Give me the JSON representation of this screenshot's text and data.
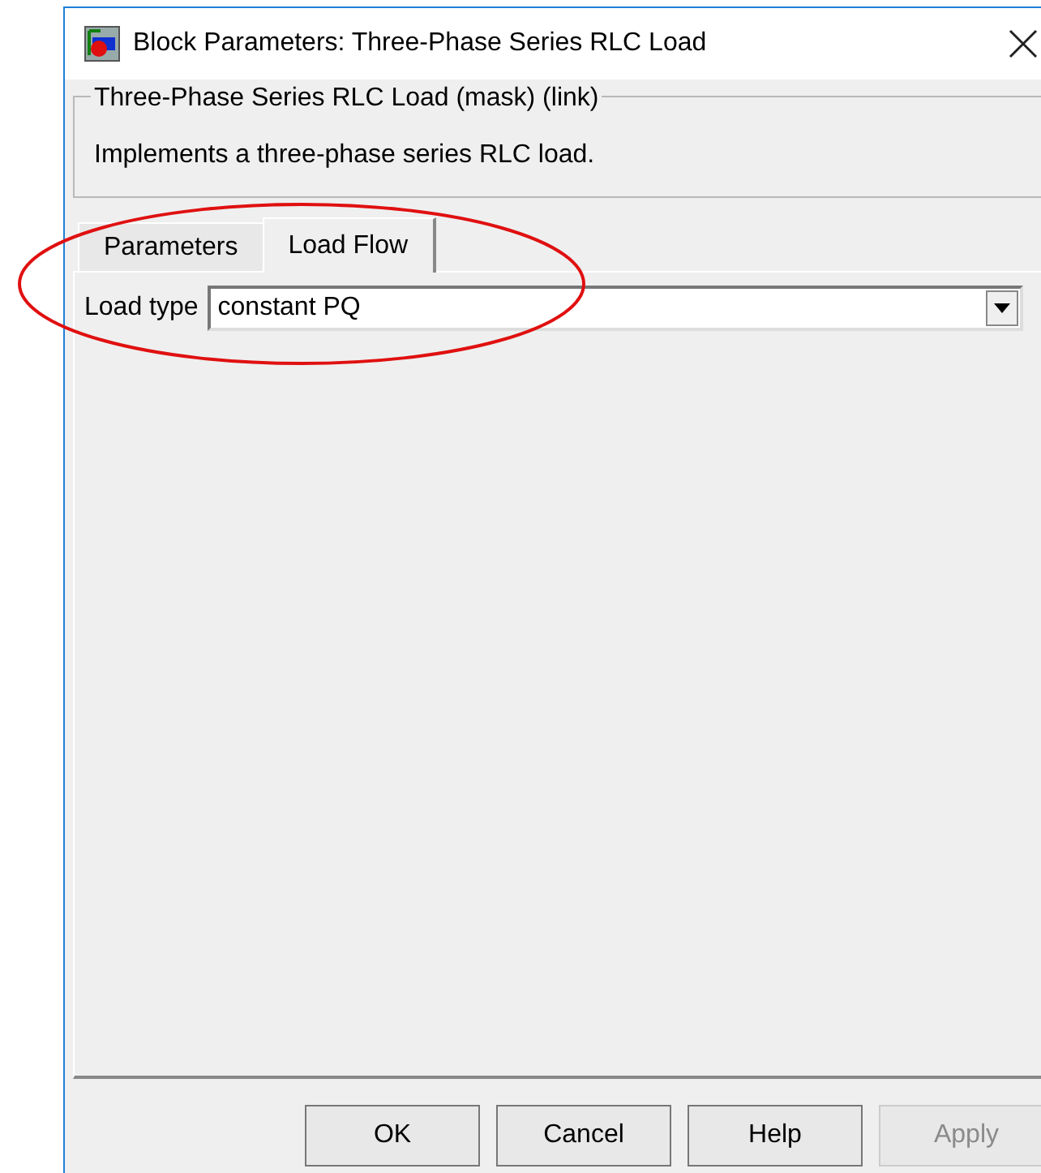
{
  "window": {
    "title": "Block Parameters: Three-Phase Series RLC Load"
  },
  "group": {
    "title": "Three-Phase Series RLC Load (mask) (link)",
    "description": "Implements a three-phase series RLC load."
  },
  "tabs": [
    {
      "label": "Parameters",
      "selected": false
    },
    {
      "label": "Load Flow",
      "selected": true
    }
  ],
  "fields": [
    {
      "label": "Load type",
      "value": "constant PQ"
    }
  ],
  "buttons": [
    {
      "label": "OK",
      "disabled": false
    },
    {
      "label": "Cancel",
      "disabled": false
    },
    {
      "label": "Help",
      "disabled": false
    },
    {
      "label": "Apply",
      "disabled": true
    }
  ]
}
